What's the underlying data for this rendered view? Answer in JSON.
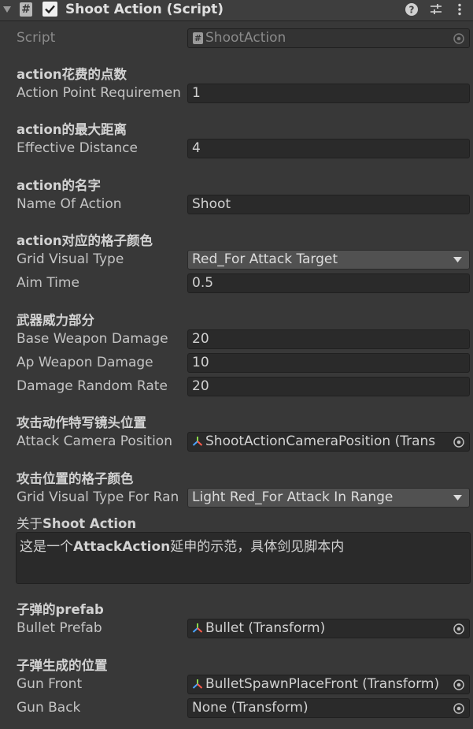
{
  "header": {
    "title": "Shoot Action (Script)",
    "enabled": true
  },
  "script_row": {
    "label": "Script",
    "value": "ShootAction"
  },
  "sections": {
    "s1": "action花费的点数",
    "s2": "action的最大距离",
    "s3": "action的名字",
    "s4": "action对应的格子颜色",
    "s5": "武器威力部分",
    "s6": "攻击动作特写镜头位置",
    "s7": "攻击位置的格子颜色",
    "s8_prefix": "关于",
    "s8_name": "Shoot Action",
    "s9": "子弹的prefab",
    "s10": "子弹生成的位置"
  },
  "fields": {
    "action_point": {
      "label": "Action Point Requiremen",
      "value": "1"
    },
    "effective_distance": {
      "label": "Effective Distance",
      "value": "4"
    },
    "name_of_action": {
      "label": "Name Of Action",
      "value": "Shoot"
    },
    "grid_visual_type": {
      "label": "Grid Visual Type",
      "value": "Red_For Attack Target"
    },
    "aim_time": {
      "label": "Aim Time",
      "value": "0.5"
    },
    "base_weapon_damage": {
      "label": "Base Weapon Damage",
      "value": "20"
    },
    "ap_weapon_damage": {
      "label": "Ap Weapon Damage",
      "value": "10"
    },
    "damage_random_rate": {
      "label": "Damage Random Rate",
      "value": "20"
    },
    "attack_camera_position": {
      "label": "Attack Camera Position",
      "value": "ShootActionCameraPosition (Trans"
    },
    "grid_visual_type_range": {
      "label": "Grid Visual Type For Ran",
      "value": "Light Red_For Attack In Range"
    },
    "description": {
      "value_prefix": "这是一个",
      "value_bold": "AttackAction",
      "value_suffix": "延申的示范，具体剑见脚本内"
    },
    "bullet_prefab": {
      "label": "Bullet Prefab",
      "value": "Bullet (Transform)"
    },
    "gun_front": {
      "label": "Gun Front",
      "value": "BulletSpawnPlaceFront (Transform)"
    },
    "gun_back": {
      "label": "Gun Back",
      "value": "None (Transform)"
    }
  },
  "icons": {
    "fold": "triangle-down-icon",
    "script": "hash-icon",
    "help": "help-icon",
    "presets": "sliders-icon",
    "menu": "kebab-menu-icon",
    "transform": "transform-icon",
    "object_picker": "object-picker-icon",
    "dropdown": "chevron-down-icon"
  }
}
